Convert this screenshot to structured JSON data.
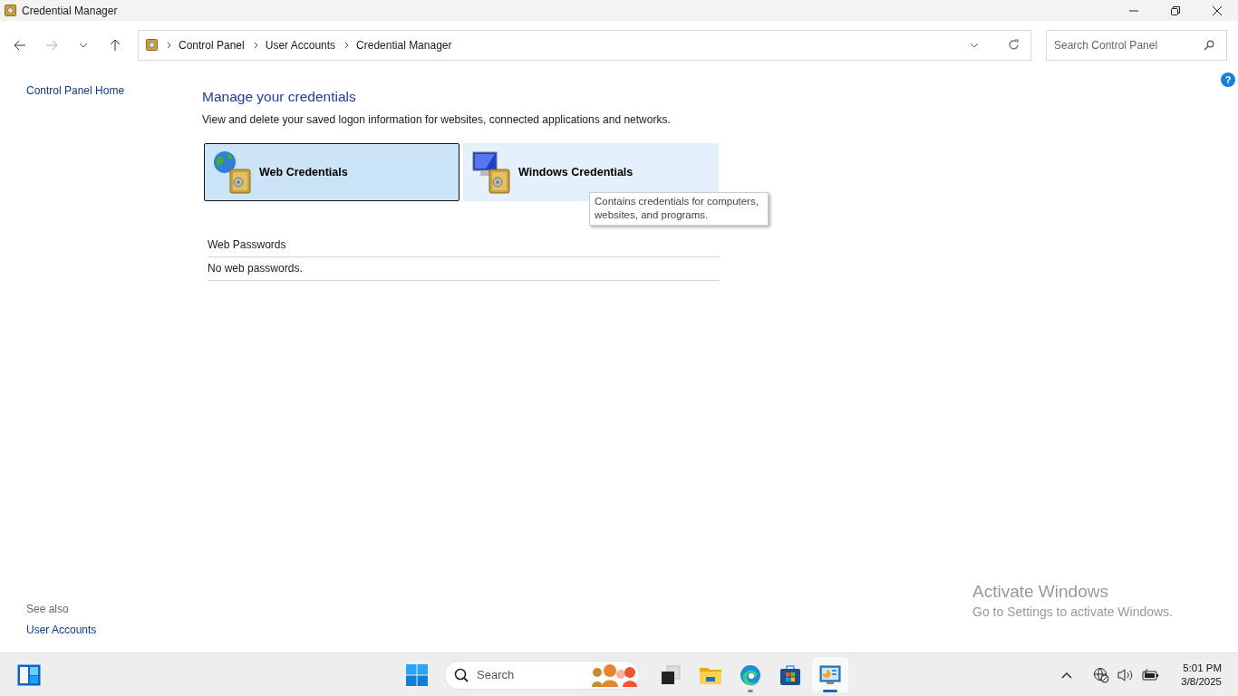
{
  "window": {
    "title": "Credential Manager"
  },
  "address_bar": {
    "breadcrumbs": [
      "Control Panel",
      "User Accounts",
      "Credential Manager"
    ]
  },
  "search": {
    "placeholder": "Search Control Panel"
  },
  "sidebar": {
    "home_link": "Control Panel Home",
    "see_also": {
      "heading": "See also",
      "links": [
        "User Accounts"
      ]
    }
  },
  "main": {
    "heading": "Manage your credentials",
    "description": "View and delete your saved logon information for websites, connected applications and networks.",
    "categories": [
      {
        "kind": "web",
        "label": "Web Credentials",
        "selected": true,
        "hovered": false
      },
      {
        "kind": "windows",
        "label": "Windows Credentials",
        "selected": false,
        "hovered": true
      }
    ],
    "tooltip": "Contains credentials for computers, websites, and programs.",
    "section": {
      "title": "Web Passwords",
      "empty_text": "No web passwords."
    }
  },
  "help": {
    "label": "?"
  },
  "activation_notice": {
    "title": "Activate Windows",
    "text": "Go to Settings to activate Windows."
  },
  "taskbar": {
    "search_placeholder": "Search",
    "apps": [
      {
        "kind": "task-view",
        "running": false,
        "selected": false
      },
      {
        "kind": "files",
        "running": false,
        "selected": false
      },
      {
        "kind": "edge",
        "running": true,
        "selected": false
      },
      {
        "kind": "store",
        "running": false,
        "selected": false
      },
      {
        "kind": "control-panel",
        "selected": true
      }
    ],
    "clock": {
      "time": "5:01 PM",
      "date": "3/8/2025"
    }
  }
}
